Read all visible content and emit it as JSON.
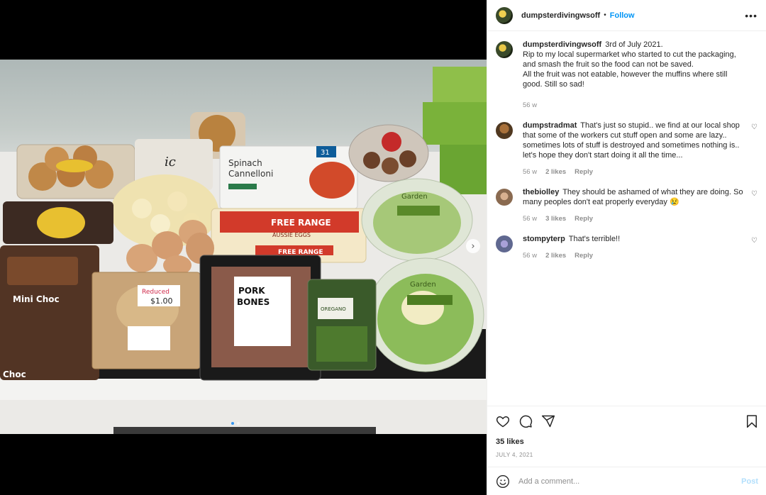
{
  "post": {
    "author": "dumpsterdivingwsoff",
    "follow_label": "Follow",
    "separator": "•",
    "more_label": "•••",
    "photo_labels": {
      "cannelloni_line1": "Spinach",
      "cannelloni_line2": "Cannelloni",
      "cannelloni_size": "31",
      "eggs_label": "FREE RANGE",
      "eggs_sub": "AUSSIE EGGS",
      "eggs_label_2": "FREE RANGE",
      "reduced_tag": "Reduced",
      "price_tag": "$1.00",
      "pork_line1": "PORK",
      "pork_line2": "BONES",
      "oregano": "OREGANO",
      "minichoc": "Mini Choc",
      "choc": "Choc",
      "garden1": "Garden",
      "garden2": "Garden"
    }
  },
  "caption": {
    "user": "dumpsterdivingwsoff",
    "lines": [
      "3rd of July 2021.",
      "Rip to my local supermarket who started to cut the packaging,",
      "and smash the fruit so the food can not be saved.",
      "All the fruit was not eatable, however the muffins where still",
      "good. Still so sad!"
    ],
    "time": "56 w"
  },
  "comments": [
    {
      "user": "dumpstradmat",
      "text": "That's just so stupid.. we find at our local shop that some of the workers cut stuff open and some are lazy.. sometimes lots of stuff is destroyed and sometimes nothing is.. let's hope they don't start doing it all the time...",
      "time": "56 w",
      "likes": "2 likes",
      "reply": "Reply"
    },
    {
      "user": "thebiolley",
      "text": "They should be ashamed of what they are doing. So many peoples don't eat properly everyday 😢",
      "time": "56 w",
      "likes": "3 likes",
      "reply": "Reply"
    },
    {
      "user": "stompyterp",
      "text": "That's terrible!!",
      "time": "56 w",
      "likes": "2 likes",
      "reply": "Reply"
    }
  ],
  "actions": {
    "likes": "35 likes",
    "date": "JULY 4, 2021"
  },
  "composer": {
    "placeholder": "Add a comment...",
    "post_label": "Post"
  },
  "icons": [
    "heart-icon",
    "comment-icon",
    "share-icon",
    "bookmark-icon",
    "emoji-icon",
    "more-icon",
    "chevron-right-icon"
  ],
  "colors": {
    "accent": "#0095f6",
    "post_disabled": "#b2dffc",
    "muted": "#8e8e8e"
  }
}
